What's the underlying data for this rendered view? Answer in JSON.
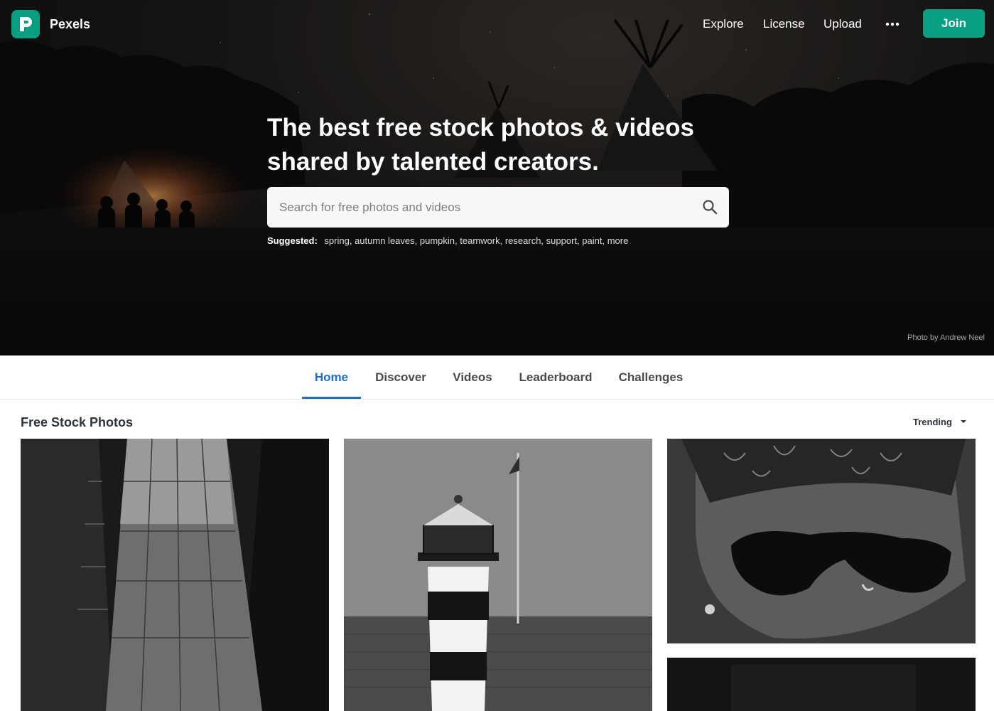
{
  "app": {
    "brand": "Pexels"
  },
  "nav": {
    "explore": "Explore",
    "license": "License",
    "upload": "Upload",
    "join": "Join"
  },
  "hero": {
    "headline_line1": "The best free stock photos & videos",
    "headline_line2": "shared by talented creators.",
    "search_placeholder": "Search for free photos and videos",
    "suggested_label": "Suggested:",
    "suggestions": [
      "spring",
      "autumn leaves",
      "pumpkin",
      "teamwork",
      "research",
      "support",
      "paint",
      "more"
    ],
    "photo_credit": "Photo by Andrew Neel"
  },
  "tabs": [
    "Home",
    "Discover",
    "Videos",
    "Leaderboard",
    "Challenges"
  ],
  "active_tab": "Home",
  "gallery": {
    "title": "Free Stock Photos",
    "sort_label": "Trending"
  },
  "icons": {
    "logo": "pexels-logo-icon",
    "more": "more-horizontal-icon",
    "search": "search-icon",
    "sort": "caret-down-icon"
  },
  "colors": {
    "brand_green": "#05a081",
    "active_tab": "#1c6fd1"
  }
}
